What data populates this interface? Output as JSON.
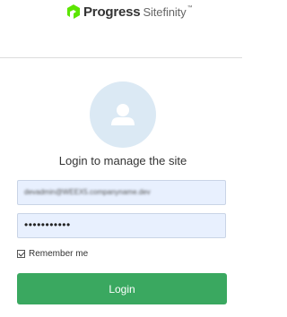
{
  "header": {
    "brand": "Progress",
    "product": "Sitefinity",
    "trademark": "™",
    "brand_color": "#5ce500"
  },
  "login": {
    "title": "Login to manage the site",
    "email_value": "devadmin@WEEX5.companyname.dev",
    "password_value": "•••••••••••",
    "remember_label": "Remember me",
    "remember_checked": true,
    "button_label": "Login",
    "button_color": "#3aa860"
  },
  "icons": {
    "logo": "progress-logo-icon",
    "avatar": "user-avatar-icon",
    "checkbox": "checkbox-checked-icon"
  }
}
